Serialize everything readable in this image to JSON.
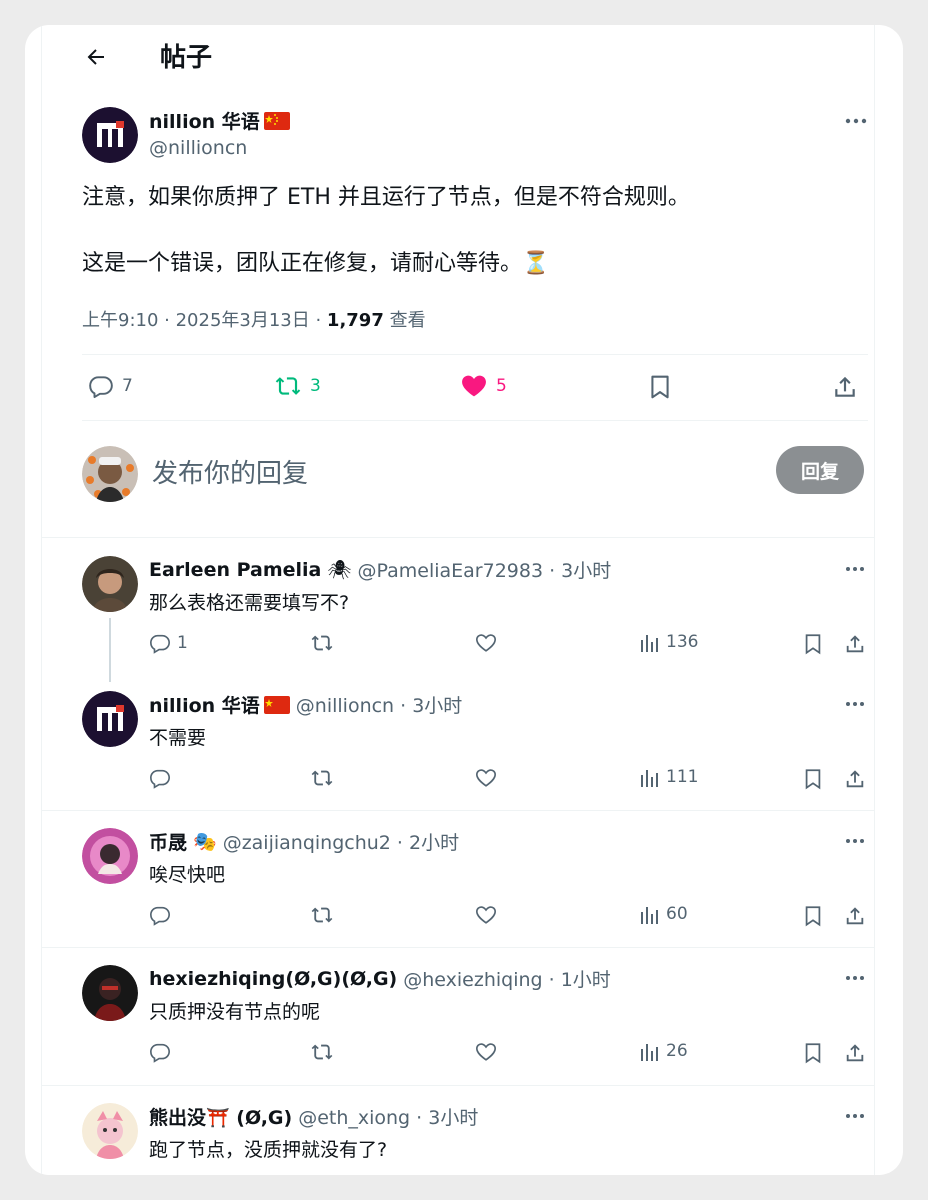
{
  "header": {
    "title": "帖子"
  },
  "post": {
    "author_name": "nillion 华语",
    "author_handle": "@nillioncn",
    "text": "注意，如果你质押了 ETH 并且运行了节点，但是不符合规则。\n\n这是一个错误，团队正在修复，请耐心等待。⏳",
    "time": "上午9:10 · 2025年3月13日 · ",
    "views_count": "1,797",
    "views_label": " 查看",
    "stats": {
      "replies": "7",
      "reposts": "3",
      "likes": "5"
    },
    "colors": {
      "repost_active": "#00ba7c",
      "like_active": "#f91880"
    }
  },
  "composer": {
    "placeholder": "发布你的回复",
    "reply_button": "回复"
  },
  "replies": [
    {
      "name": "Earleen Pamelia",
      "handle": "@PameliaEar72983 · 3小时",
      "text": "那么表格还需要填写不?",
      "replies": "1",
      "views": "136"
    },
    {
      "name": "nillion 华语",
      "handle": "@nillioncn · 3小时",
      "text": "不需要",
      "replies": "",
      "views": "111"
    },
    {
      "name": "币晟",
      "handle": "@zaijianqingchu2 · 2小时",
      "text": "唉尽快吧",
      "replies": "",
      "views": "60"
    },
    {
      "name": "hexiezhiqing(Ø,G)(Ø,G)",
      "handle": "@hexiezhiqing · 1小时",
      "text": "只质押没有节点的呢",
      "replies": "",
      "views": "26"
    },
    {
      "name": "熊出没⛩️ (Ø,G)",
      "handle": "@eth_xiong · 3小时",
      "text": "跑了节点，没质押就没有了?",
      "replies": "",
      "views": ""
    }
  ]
}
